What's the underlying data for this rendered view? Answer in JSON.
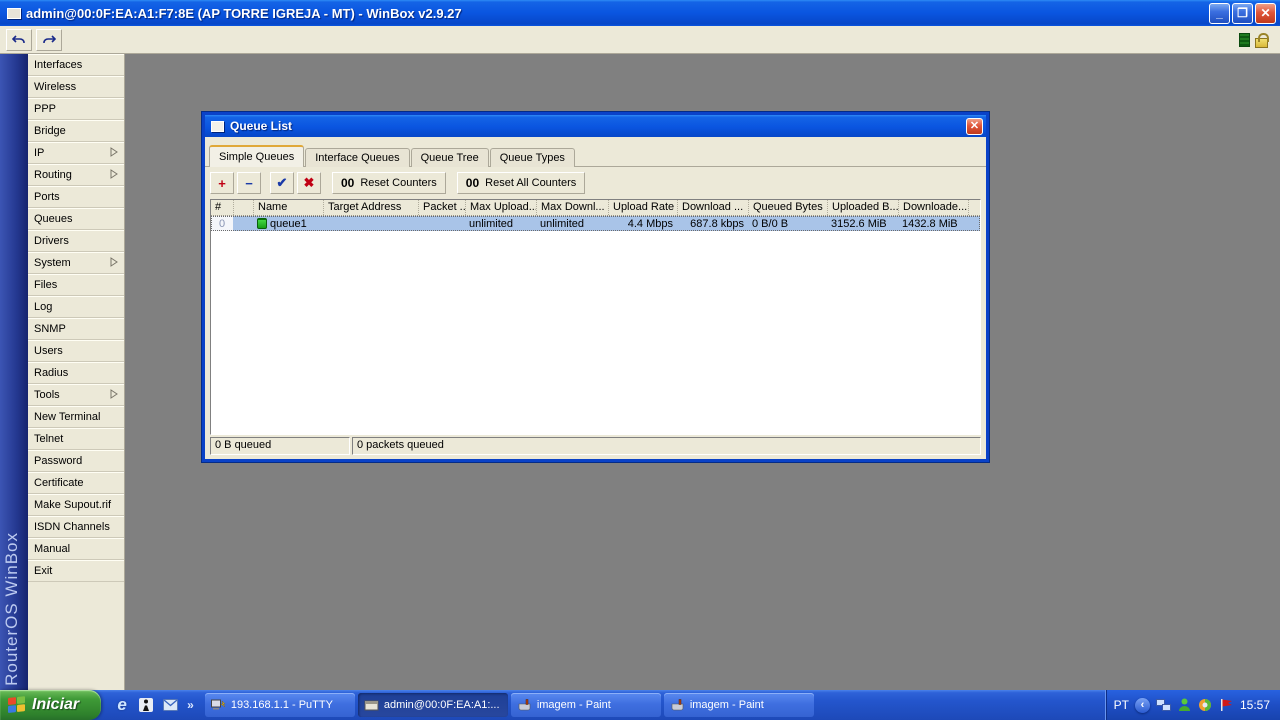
{
  "app": {
    "title": "admin@00:0F:EA:A1:F7:8E (AP TORRE IGREJA - MT) - WinBox v2.9.27",
    "brand_vertical": "RouterOS WinBox",
    "window_controls": {
      "minimize": "_",
      "restore": "❐",
      "close": "✕"
    }
  },
  "icons": {
    "plus": "+",
    "minus": "−",
    "check": "✔",
    "cross": "✖",
    "overflow_chevron": "»",
    "tray_chevron": "‹",
    "ie_letter": "e"
  },
  "colors": {
    "titlebar_blue": "#0a55e0",
    "desktop_gray": "#808080",
    "panel_beige": "#ece9d8",
    "selection_blue": "#a9c4e8",
    "taskbar_blue": "#2456cd",
    "start_green": "#3f9a37",
    "brand_strip_blue": "#243890"
  },
  "sidebar": {
    "items": [
      {
        "label": "Interfaces"
      },
      {
        "label": "Wireless"
      },
      {
        "label": "PPP"
      },
      {
        "label": "Bridge"
      },
      {
        "label": "IP",
        "submenu": true
      },
      {
        "label": "Routing",
        "submenu": true
      },
      {
        "label": "Ports"
      },
      {
        "label": "Queues"
      },
      {
        "label": "Drivers"
      },
      {
        "label": "System",
        "submenu": true
      },
      {
        "label": "Files"
      },
      {
        "label": "Log"
      },
      {
        "label": "SNMP"
      },
      {
        "label": "Users"
      },
      {
        "label": "Radius"
      },
      {
        "label": "Tools",
        "submenu": true
      },
      {
        "label": "New Terminal"
      },
      {
        "label": "Telnet"
      },
      {
        "label": "Password"
      },
      {
        "label": "Certificate"
      },
      {
        "label": "Make Supout.rif"
      },
      {
        "label": "ISDN Channels"
      },
      {
        "label": "Manual"
      },
      {
        "label": "Exit"
      }
    ]
  },
  "queue_window": {
    "title": "Queue List",
    "close": "✕",
    "tabs": [
      "Simple Queues",
      "Interface Queues",
      "Queue Tree",
      "Queue Types"
    ],
    "active_tab": "Simple Queues",
    "toolbar": {
      "zero_prefix": "00",
      "reset_counters": "Reset Counters",
      "reset_all_counters": "Reset All Counters"
    },
    "table": {
      "columns": [
        "#",
        "",
        "Name",
        "Target Address",
        "Packet ...",
        "Max Upload...",
        "Max Downl...",
        "Upload Rate",
        "Download ...",
        "Queued Bytes",
        "Uploaded B...",
        "Downloade..."
      ],
      "rows": [
        {
          "num": "0",
          "name": "queue1",
          "target_address": "",
          "packet": "",
          "max_upload": "unlimited",
          "max_download": "unlimited",
          "upload_rate": "4.4 Mbps",
          "download_rate": "687.8 kbps",
          "queued_bytes": "0 B/0 B",
          "uploaded_bytes": "3152.6 MiB",
          "downloaded_bytes": "1432.8 MiB"
        }
      ]
    },
    "statusbar": {
      "left": "0 B queued",
      "right": "0 packets queued"
    }
  },
  "taskbar": {
    "start_label": "Iniciar",
    "buttons": [
      {
        "label": "193.168.1.1 - PuTTY",
        "active": false
      },
      {
        "label": "admin@00:0F:EA:A1:...",
        "active": true
      },
      {
        "label": "imagem - Paint",
        "active": false
      },
      {
        "label": "imagem - Paint",
        "active": false
      }
    ],
    "tray": {
      "lang": "PT",
      "time": "15:57"
    }
  }
}
